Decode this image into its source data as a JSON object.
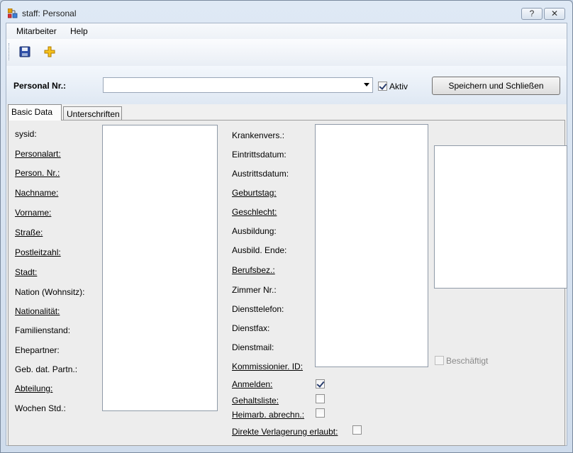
{
  "window": {
    "title": "staff: Personal",
    "help_glyph": "?",
    "close_glyph": "✕"
  },
  "menu": [
    "Mitarbeiter",
    "Help"
  ],
  "toolbar": {
    "save_icon": "save-icon",
    "add_icon": "add-icon"
  },
  "header": {
    "personal_nr_label": "Personal Nr.:",
    "personal_nr_value": "",
    "aktiv_label": "Aktiv",
    "aktiv_checked": true,
    "save_close_label": "Speichern und Schließen"
  },
  "tabs": [
    {
      "label": "Basic Data",
      "active": true
    },
    {
      "label": "Unterschriften",
      "active": false
    }
  ],
  "left_fields": [
    {
      "label": "sysid:",
      "underlined": false
    },
    {
      "label": "Personalart:",
      "underlined": true
    },
    {
      "label": "Person. Nr.:",
      "underlined": true
    },
    {
      "label": "Nachname:",
      "underlined": true
    },
    {
      "label": "Vorname:",
      "underlined": true
    },
    {
      "label": "Straße:",
      "underlined": true
    },
    {
      "label": "Postleitzahl:",
      "underlined": true
    },
    {
      "label": "Stadt:",
      "underlined": true
    },
    {
      "label": "Nation (Wohnsitz):",
      "underlined": false
    },
    {
      "label": "Nationalität:",
      "underlined": true
    },
    {
      "label": "Familienstand:",
      "underlined": false
    },
    {
      "label": "Ehepartner:",
      "underlined": false
    },
    {
      "label": "Geb. dat. Partn.:",
      "underlined": false
    },
    {
      "label": "Abteilung:",
      "underlined": true
    },
    {
      "label": "Wochen Std.:",
      "underlined": false
    }
  ],
  "middle_fields": [
    {
      "label": "Krankenvers.:",
      "underlined": false
    },
    {
      "label": "Eintrittsdatum:",
      "underlined": false
    },
    {
      "label": "Austrittsdatum:",
      "underlined": false
    },
    {
      "label": "Geburtstag:",
      "underlined": true
    },
    {
      "label": "Geschlecht:",
      "underlined": true
    },
    {
      "label": "Ausbildung:",
      "underlined": false
    },
    {
      "label": "Ausbild. Ende:",
      "underlined": false
    },
    {
      "label": "Berufsbez.:",
      "underlined": true
    },
    {
      "label": "Zimmer Nr.:",
      "underlined": false
    },
    {
      "label": "Diensttelefon:",
      "underlined": false
    },
    {
      "label": "Dienstfax:",
      "underlined": false
    },
    {
      "label": "Dienstmail:",
      "underlined": false
    },
    {
      "label": "Kommissionier. ID:",
      "underlined": true
    }
  ],
  "check_fields": [
    {
      "label": "Anmelden:",
      "checked": true
    },
    {
      "label": "Gehaltsliste:",
      "checked": false
    },
    {
      "label": "Heimarb. abrechn.:",
      "checked": false
    },
    {
      "label": "Direkte Verlagerung erlaubt:",
      "checked": false
    }
  ],
  "beschaeftigt": {
    "label": "Beschäftigt",
    "checked": false,
    "enabled": false
  }
}
